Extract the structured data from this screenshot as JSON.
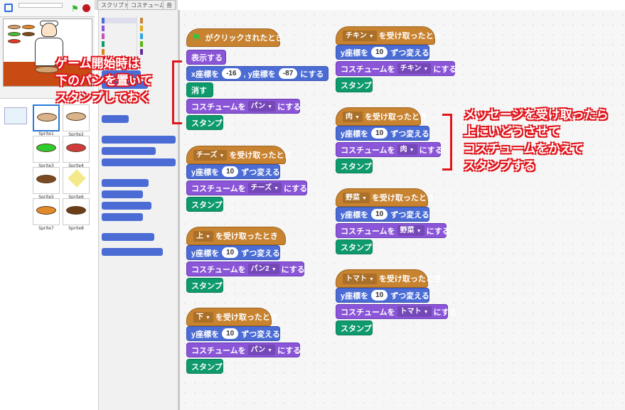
{
  "tabs": [
    "スクリプト",
    "コスチューム",
    "音"
  ],
  "scripts": {
    "flag_script": {
      "hat": "がクリックされたとき",
      "b1": "表示する",
      "b2_x": "x座標を",
      "b2_xval": "-16",
      "b2_y": ", y座標を",
      "b2_yval": "-87",
      "b2_end": "にする",
      "b3": "消す",
      "b4": "コスチュームを",
      "b4_val": "パン",
      "b4_end": "にする",
      "b5": "スタンプ"
    },
    "common": {
      "recv": "を受け取ったとき",
      "ychange": "y座標を",
      "yval": "10",
      "ychange_end": "ずつ変える",
      "costume": "コスチュームを",
      "costume_end": "にする",
      "stamp": "スタンプ"
    },
    "receivers": [
      {
        "msg": "チーズ",
        "costume": "チーズ"
      },
      {
        "msg": "上",
        "costume": "パン2"
      },
      {
        "msg": "下",
        "costume": "パン"
      },
      {
        "msg": "チキン",
        "costume": "チキン"
      },
      {
        "msg": "肉",
        "costume": "肉"
      },
      {
        "msg": "野菜",
        "costume": "野菜"
      },
      {
        "msg": "トマト",
        "costume": "トマト"
      }
    ]
  },
  "annotations": {
    "left": [
      "ゲーム開始時は",
      "下のパンを置いて",
      "スタンプしておく"
    ],
    "right": [
      "メッセージを受け取ったら",
      "上にいどうさせて",
      "コスチュームをかえて",
      "スタンプする"
    ]
  },
  "sprites": [
    "Sprite1",
    "Sprite2",
    "Sprite3",
    "Sprite4",
    "Sprite5",
    "Sprite6",
    "Sprite7",
    "Sprite8"
  ],
  "colors": {
    "event": "#c88330",
    "looks": "#8a55d7",
    "motion": "#4a6cd4",
    "pen": "#0e9a6c",
    "annotation": "#e0151c"
  }
}
